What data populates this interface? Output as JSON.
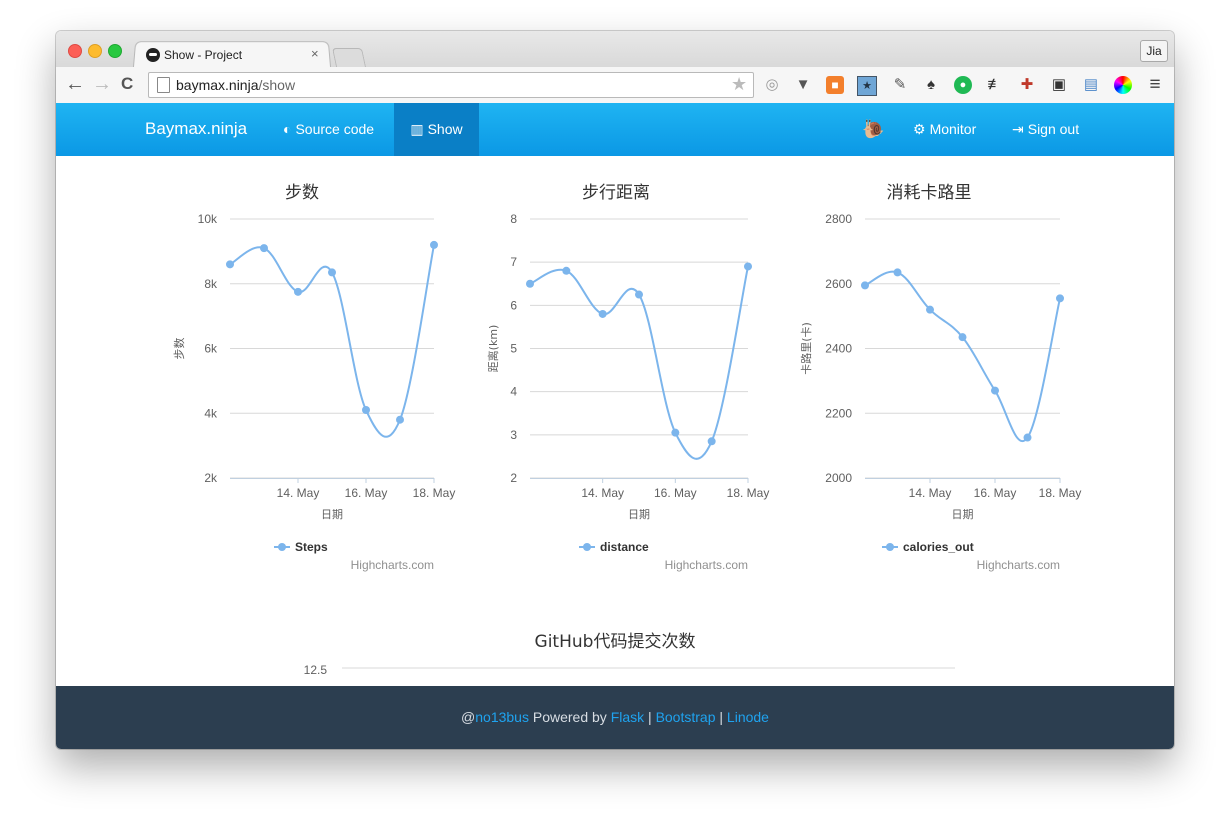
{
  "browser": {
    "tab_title": "Show - Project",
    "tab_close": "×",
    "profile_name": "Jia",
    "url_host": "baymax.ninja",
    "url_path": "/show",
    "back": "←",
    "forward": "→",
    "reload": "C",
    "menu": "≡"
  },
  "navbar": {
    "brand": "Baymax.ninja",
    "source_code": "Source code",
    "show": "Show",
    "monitor": "Monitor",
    "sign_out": "Sign out",
    "colors": {
      "bar": "#1aa9ee",
      "active": "#0a7fc6"
    }
  },
  "chart_data": [
    {
      "type": "line",
      "title": "步数",
      "xlabel": "日期",
      "ylabel": "步数",
      "x": [
        "2015-05-12",
        "2015-05-13",
        "2015-05-14",
        "2015-05-15",
        "2015-05-16",
        "2015-05-17",
        "2015-05-18"
      ],
      "xticks": [
        "14. May",
        "16. May",
        "18. May"
      ],
      "yticks": [
        "2k",
        "4k",
        "6k",
        "8k",
        "10k"
      ],
      "ylim": [
        2000,
        10000
      ],
      "series": [
        {
          "name": "Steps",
          "values": [
            8600,
            9100,
            7750,
            8350,
            4100,
            3800,
            9200
          ]
        }
      ],
      "credit": "Highcharts.com",
      "color": "#7cb5ec"
    },
    {
      "type": "line",
      "title": "步行距离",
      "xlabel": "日期",
      "ylabel": "距离(km)",
      "x": [
        "2015-05-12",
        "2015-05-13",
        "2015-05-14",
        "2015-05-15",
        "2015-05-16",
        "2015-05-17",
        "2015-05-18"
      ],
      "xticks": [
        "14. May",
        "16. May",
        "18. May"
      ],
      "yticks": [
        "2",
        "3",
        "4",
        "5",
        "6",
        "7",
        "8"
      ],
      "ylim": [
        2,
        8
      ],
      "series": [
        {
          "name": "distance",
          "values": [
            6.5,
            6.8,
            5.8,
            6.25,
            3.05,
            2.85,
            6.9
          ]
        }
      ],
      "credit": "Highcharts.com",
      "color": "#7cb5ec"
    },
    {
      "type": "line",
      "title": "消耗卡路里",
      "xlabel": "日期",
      "ylabel": "卡路里(卡)",
      "x": [
        "2015-05-12",
        "2015-05-13",
        "2015-05-14",
        "2015-05-15",
        "2015-05-16",
        "2015-05-17",
        "2015-05-18"
      ],
      "xticks": [
        "14. May",
        "16. May",
        "18. May"
      ],
      "yticks": [
        "2000",
        "2200",
        "2400",
        "2600",
        "2800"
      ],
      "ylim": [
        2000,
        2800
      ],
      "series": [
        {
          "name": "calories_out",
          "values": [
            2595,
            2635,
            2520,
            2435,
            2270,
            2125,
            2555
          ]
        }
      ],
      "credit": "Highcharts.com",
      "color": "#7cb5ec"
    },
    {
      "type": "line",
      "title": "GitHub代码提交次数",
      "yticks": [
        "12.5"
      ],
      "series": []
    }
  ],
  "footer": {
    "at": "@",
    "user": "no13bus",
    "powered": " Powered by ",
    "flask": "Flask",
    "sep": " | ",
    "bootstrap": "Bootstrap",
    "linode": "Linode"
  }
}
